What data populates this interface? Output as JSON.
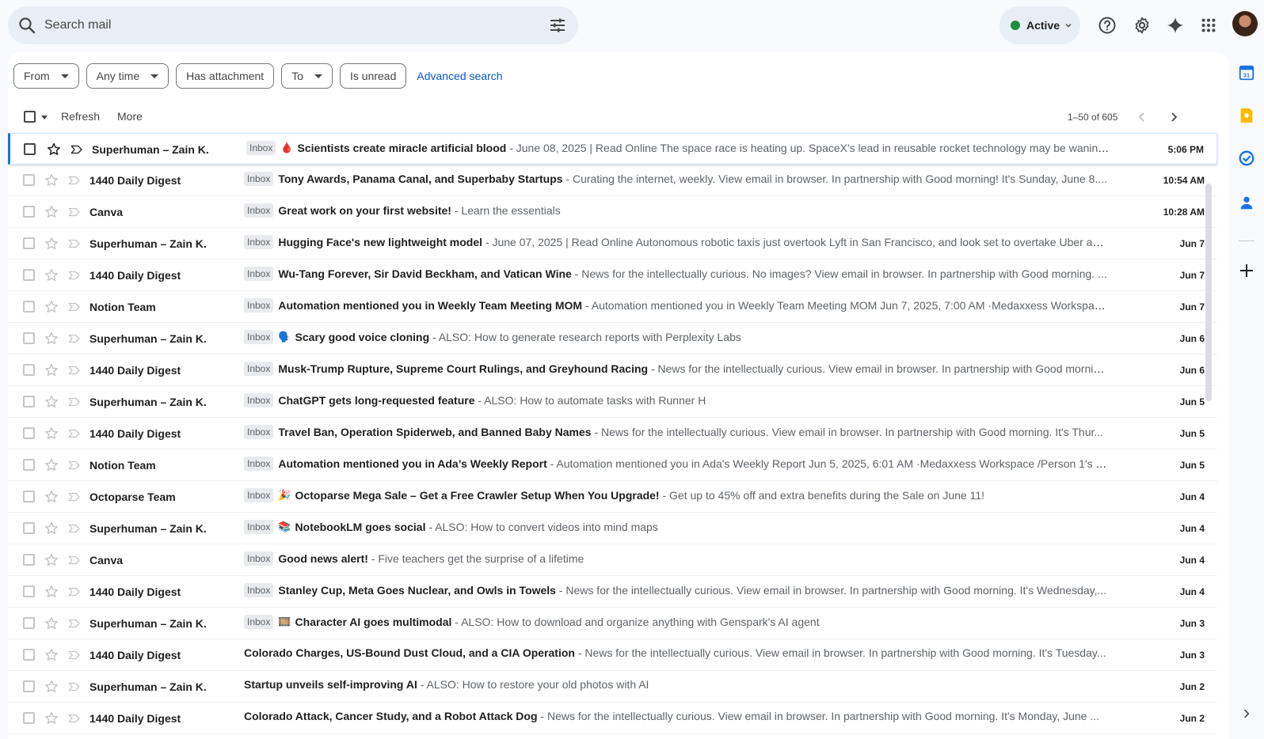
{
  "search": {
    "placeholder": "Search mail"
  },
  "status": {
    "label": "Active",
    "color": "#1e8e3e"
  },
  "top_icons": [
    "help-icon",
    "gear-icon",
    "gemini-sparkle-icon",
    "apps-grid-icon",
    "avatar"
  ],
  "filters": {
    "chips": [
      {
        "label": "From",
        "dropdown": true
      },
      {
        "label": "Any time",
        "dropdown": true
      },
      {
        "label": "Has attachment",
        "dropdown": false
      },
      {
        "label": "To",
        "dropdown": true
      },
      {
        "label": "Is unread",
        "dropdown": false
      }
    ],
    "advanced": "Advanced search"
  },
  "toolbar": {
    "refresh": "Refresh",
    "more": "More",
    "count": "1–50 of 605"
  },
  "emails": [
    {
      "sender": "Superhuman – Zain K.",
      "inbox": true,
      "emoji": "🩸",
      "subject": "Scientists create miracle artificial blood",
      "snippet": " - June 08, 2025 | Read Online The space race is heating up. SpaceX's lead in reusable rocket technology may be waning...",
      "date": "5:06 PM"
    },
    {
      "sender": "1440 Daily Digest",
      "inbox": true,
      "emoji": "",
      "subject": "Tony Awards, Panama Canal, and Superbaby Startups",
      "snippet": " - Curating the internet, weekly. View email in browser. In partnership with Good morning! It's Sunday, June 8....",
      "date": "10:54 AM"
    },
    {
      "sender": "Canva",
      "inbox": true,
      "emoji": "",
      "subject": "Great work on your first website!",
      "snippet": " - Learn the essentials",
      "date": "10:28 AM"
    },
    {
      "sender": "Superhuman – Zain K.",
      "inbox": true,
      "emoji": "",
      "subject": "Hugging Face's new lightweight model",
      "snippet": " - June 07, 2025 | Read Online Autonomous robotic taxis just overtook Lyft in San Francisco, and look set to overtake Uber as ...",
      "date": "Jun 7"
    },
    {
      "sender": "1440 Daily Digest",
      "inbox": true,
      "emoji": "",
      "subject": "Wu-Tang Forever, Sir David Beckham, and Vatican Wine",
      "snippet": " - News for the intellectually curious. No images? View email in browser. In partnership with Good morning. ...",
      "date": "Jun 7"
    },
    {
      "sender": "Notion Team",
      "inbox": true,
      "emoji": "",
      "subject": "Automation mentioned you in Weekly Team Meeting MOM",
      "snippet": " - Automation mentioned you in Weekly Team Meeting MOM Jun 7, 2025, 7:00 AM ·Medaxxess Workspac...",
      "date": "Jun 7"
    },
    {
      "sender": "Superhuman – Zain K.",
      "inbox": true,
      "emoji": "🗣️",
      "subject": "Scary good voice cloning",
      "snippet": " - ALSO: How to generate research reports with Perplexity Labs",
      "date": "Jun 6"
    },
    {
      "sender": "1440 Daily Digest",
      "inbox": true,
      "emoji": "",
      "subject": "Musk-Trump Rupture, Supreme Court Rulings, and Greyhound Racing",
      "snippet": " - News for the intellectually curious. View email in browser. In partnership with Good mornin...",
      "date": "Jun 6"
    },
    {
      "sender": "Superhuman – Zain K.",
      "inbox": true,
      "emoji": "",
      "subject": "ChatGPT gets long-requested feature",
      "snippet": " - ALSO: How to automate tasks with Runner H",
      "date": "Jun 5"
    },
    {
      "sender": "1440 Daily Digest",
      "inbox": true,
      "emoji": "",
      "subject": "Travel Ban, Operation Spiderweb, and Banned Baby Names",
      "snippet": " - News for the intellectually curious. View email in browser. In partnership with Good morning. It's Thur...",
      "date": "Jun 5"
    },
    {
      "sender": "Notion Team",
      "inbox": true,
      "emoji": "",
      "subject": "Automation mentioned you in Ada’s Weekly Report",
      "snippet": " - Automation mentioned you in Ada's Weekly Report Jun 5, 2025, 6:01 AM ·Medaxxess Workspace /Person 1's T...",
      "date": "Jun 5"
    },
    {
      "sender": "Octoparse Team",
      "inbox": true,
      "emoji": "🎉",
      "subject": "Octoparse Mega Sale – Get a Free Crawler Setup When You Upgrade!",
      "snippet": " - Get up to 45% off and extra benefits during the Sale on June 11!",
      "date": "Jun 4"
    },
    {
      "sender": "Superhuman – Zain K.",
      "inbox": true,
      "emoji": "📚",
      "subject": "NotebookLM goes social",
      "snippet": " - ALSO: How to convert videos into mind maps",
      "date": "Jun 4"
    },
    {
      "sender": "Canva",
      "inbox": true,
      "emoji": "",
      "subject": "Good news alert!",
      "snippet": " - Five teachers get the surprise of a lifetime",
      "date": "Jun 4"
    },
    {
      "sender": "1440 Daily Digest",
      "inbox": true,
      "emoji": "",
      "subject": "Stanley Cup, Meta Goes Nuclear, and Owls in Towels",
      "snippet": " - News for the intellectually curious. View email in browser. In partnership with Good morning. It's Wednesday,...",
      "date": "Jun 4"
    },
    {
      "sender": "Superhuman – Zain K.",
      "inbox": true,
      "emoji": "🎞️",
      "subject": "Character AI goes multimodal",
      "snippet": " - ALSO: How to download and organize anything with Genspark's AI agent",
      "date": "Jun 3"
    },
    {
      "sender": "1440 Daily Digest",
      "inbox": false,
      "emoji": "",
      "subject": "Colorado Charges, US-Bound Dust Cloud, and a CIA Operation",
      "snippet": " - News for the intellectually curious. View email in browser. In partnership with Good morning. It's Tuesday...",
      "date": "Jun 3"
    },
    {
      "sender": "Superhuman – Zain K.",
      "inbox": false,
      "emoji": "",
      "subject": "Startup unveils self-improving AI",
      "snippet": " - ALSO: How to restore your old photos with AI",
      "date": "Jun 2"
    },
    {
      "sender": "1440 Daily Digest",
      "inbox": false,
      "emoji": "",
      "subject": "Colorado Attack, Cancer Study, and a Robot Attack Dog",
      "snippet": " - News for the intellectually curious. View email in browser. In partnership with Good morning. It's Monday, June ...",
      "date": "Jun 2"
    }
  ],
  "inbox_label": "Inbox",
  "side_panel": [
    "calendar-icon",
    "keep-icon",
    "tasks-icon",
    "contacts-icon",
    "add-icon"
  ]
}
